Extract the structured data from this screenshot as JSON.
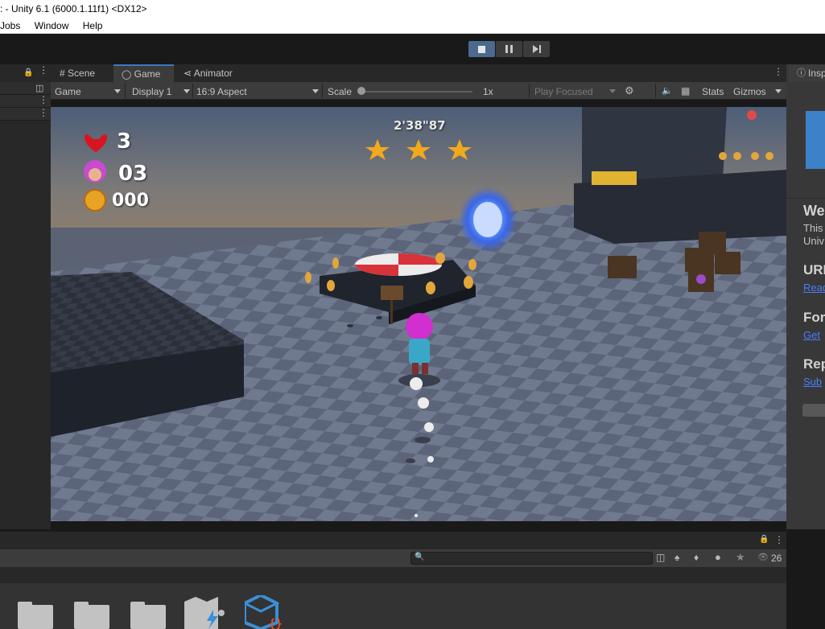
{
  "window": {
    "title": ": - Unity 6.1 (6000.1.11f1) <DX12>"
  },
  "menu": {
    "items": [
      "Jobs",
      "Window",
      "Help"
    ]
  },
  "playbar": {
    "play_active": true,
    "pause_label": "Pause",
    "step_label": "Step"
  },
  "tabs": [
    {
      "label": "Scene",
      "icon": "grid-icon",
      "active": false
    },
    {
      "label": "Game",
      "icon": "gamepad-icon",
      "active": true
    },
    {
      "label": "Animator",
      "icon": "animator-icon",
      "active": false
    }
  ],
  "game_toolbar": {
    "view_mode": "Game",
    "display": "Display 1",
    "aspect": "16:9 Aspect",
    "scale_label": "Scale",
    "scale_value": "1x",
    "play_mode": "Play Focused",
    "stats": "Stats",
    "gizmos": "Gizmos"
  },
  "hud": {
    "lives": "3",
    "characters": "03",
    "coins": "000",
    "timer": "2'38\"87",
    "stars": 3
  },
  "inspector": {
    "tab_label": "Insp",
    "section_title": "We",
    "body_lines": [
      "This",
      "Univ"
    ],
    "sections": [
      {
        "heading": "URI",
        "link": "Read"
      },
      {
        "heading": "For",
        "link": "Get"
      },
      {
        "heading": "Rep",
        "link": "Sub"
      }
    ]
  },
  "project": {
    "search_placeholder": "",
    "hidden_count": "26",
    "assets": [
      "folder",
      "folder",
      "folder",
      "map-asset",
      "package-asset"
    ]
  },
  "colors": {
    "accent": "#3a79bb",
    "play_active": "#4b6a8e",
    "link": "#4c7eff",
    "portal": "#4f8dff",
    "gold": "#f2a91c"
  }
}
